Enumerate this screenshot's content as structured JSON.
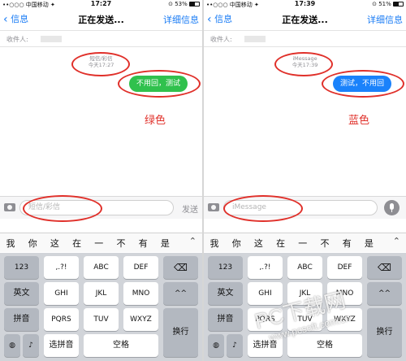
{
  "left": {
    "status": {
      "carrier": "••○○○ 中国移动 ✦",
      "time": "17:27",
      "battery": "⊙ 53%",
      "battery_level": 0.53
    },
    "nav": {
      "back_label": "信息",
      "title": "正在发送...",
      "details_label": "详细信息"
    },
    "recipient": {
      "label": "收件人:"
    },
    "timestamp": {
      "service": "短信/彩信",
      "time": "今天17:27"
    },
    "bubble": {
      "text": "不用回，测试",
      "color": "#30c14d"
    },
    "annotation": "绿色",
    "input": {
      "placeholder": "短信/彩信",
      "send_label": "发送"
    }
  },
  "right": {
    "status": {
      "carrier": "••○○○ 中国移动 ✦",
      "time": "17:39",
      "battery": "⊙ 51%",
      "battery_level": 0.51
    },
    "nav": {
      "back_label": "信息",
      "title": "正在发送...",
      "details_label": "详细信息"
    },
    "recipient": {
      "label": "收件人:"
    },
    "timestamp": {
      "service": "iMessage",
      "time": "今天17:39"
    },
    "bubble": {
      "text": "测试，不用回",
      "color": "#1a82fb"
    },
    "annotation": "蓝色",
    "input": {
      "placeholder": "iMessage"
    }
  },
  "keyboard": {
    "candidates": [
      "我",
      "你",
      "这",
      "在",
      "一",
      "不",
      "有",
      "是"
    ],
    "rows": [
      [
        "123",
        ",.?!",
        "ABC",
        "DEF"
      ],
      [
        "英文",
        "GHI",
        "JKL",
        "MNO"
      ],
      [
        "拼音",
        "PQRS",
        "TUV",
        "WXYZ"
      ]
    ],
    "bottom": {
      "pinyin_select": "选拼音",
      "space": "空格"
    },
    "side": {
      "backspace": "⌫",
      "emoticon": "^^",
      "return": "换行"
    }
  },
  "watermark": {
    "title": "PC下载网",
    "url": "www.pcsoft.com.cn"
  },
  "colors": {
    "ios_blue": "#1a7cf5",
    "annotation_red": "#e0302a",
    "sms_green": "#30c14d",
    "imessage_blue": "#1a82fb"
  }
}
